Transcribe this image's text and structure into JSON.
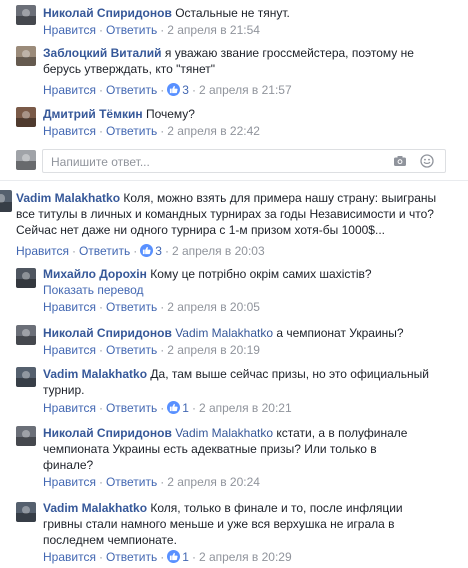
{
  "actions": {
    "reply": "Ответить",
    "like": "Нравится",
    "translate": "Показать перевод"
  },
  "reply_box": {
    "placeholder": "Напишите ответ..."
  },
  "comments": [
    {
      "author": "Николай Спиридонов",
      "text": "Остальные не тянут.",
      "time": "2 апреля в 21:54"
    },
    {
      "author": "Заблоцкий Виталий",
      "text_line1": "я уважаю звание гроссмейстера, поэтому не",
      "text_line2": "берусь утверждать, кто \"тянет\"",
      "likes": "3",
      "time": "2 апреля в 21:57"
    },
    {
      "author": "Дмитрий Тёмкин",
      "text": "Почему?",
      "time": "2 апреля в 22:42"
    },
    {
      "author": "Vadim Malakhatko",
      "text_line1": "Коля, можно взять для примера нашу страну: выиграны",
      "text_line2": "все титулы в личных и командных турнирах за годы Независимости и что?",
      "text_line3": "Сейчас нет даже ни одного турнира с 1-м призом хотя-бы 1000$...",
      "likes": "3",
      "time": "2 апреля в 20:03"
    },
    {
      "author": "Михайло Дорохін",
      "text": "Кому це потрібно окрім самих шахістів?",
      "time": "2 апреля в 20:05"
    },
    {
      "author": "Николай Спиридонов",
      "mention": "Vadim Malakhatko",
      "text": "а чемпионат Украины?",
      "time": "2 апреля в 20:19"
    },
    {
      "author": "Vadim Malakhatko",
      "text_line1": "Да, там выше сейчас призы, но это официальный",
      "text_line2": "турнир.",
      "likes": "1",
      "time": "2 апреля в 20:21"
    },
    {
      "author": "Николай Спиридонов",
      "mention": "Vadim Malakhatko",
      "text_line1": "кстати, а в полуфинале",
      "text_line2": "чемпионата Украины есть адекватные призы? Или только в",
      "text_line3": "финале?",
      "time": "2 апреля в 20:24"
    },
    {
      "author": "Vadim Malakhatko",
      "text_line1": "Коля, только в финале и то, после инфляции",
      "text_line2": "гривны стали намного меньше и уже вся верхушка не играла в",
      "text_line3": "последнем чемпионате.",
      "likes": "1",
      "time": "2 апреля в 20:29"
    }
  ]
}
